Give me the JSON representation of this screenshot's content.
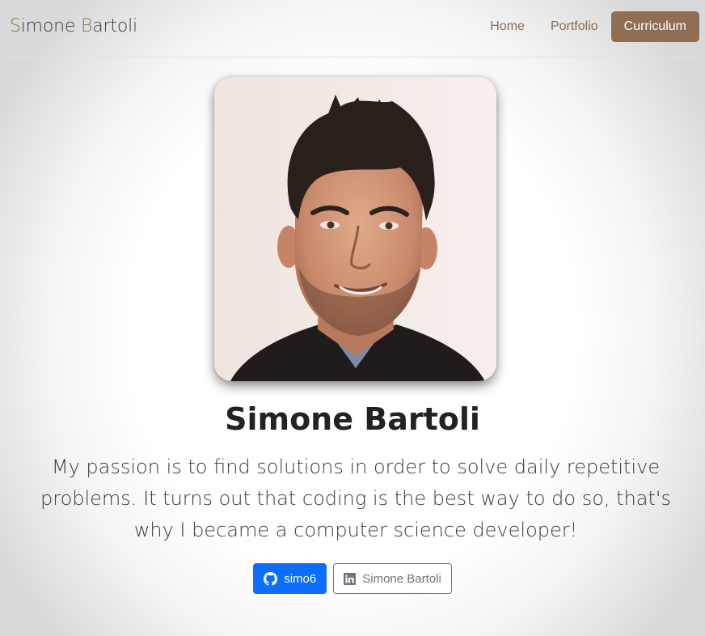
{
  "navbar": {
    "brand_first": "S",
    "brand_rest_1": "imone ",
    "brand_second": "B",
    "brand_rest_2": "artoli",
    "links": [
      "Home",
      "Portfolio",
      "Curriculum"
    ],
    "active_link": "Curriculum"
  },
  "profile": {
    "name": "Simone Bartoli",
    "bio": "My passion is to find solutions in order to solve daily repetitive problems. It turns out that coding is the best way to do so, that's why I became a computer science developer!"
  },
  "social": {
    "github": {
      "label": "simo6",
      "icon": "github-icon"
    },
    "linkedin": {
      "label": "Simone Bartoli",
      "icon": "linkedin-icon"
    }
  },
  "colors": {
    "accent": "#8f6e53",
    "github_button": "#0d6efd",
    "linkedin_border": "#6c757d"
  }
}
